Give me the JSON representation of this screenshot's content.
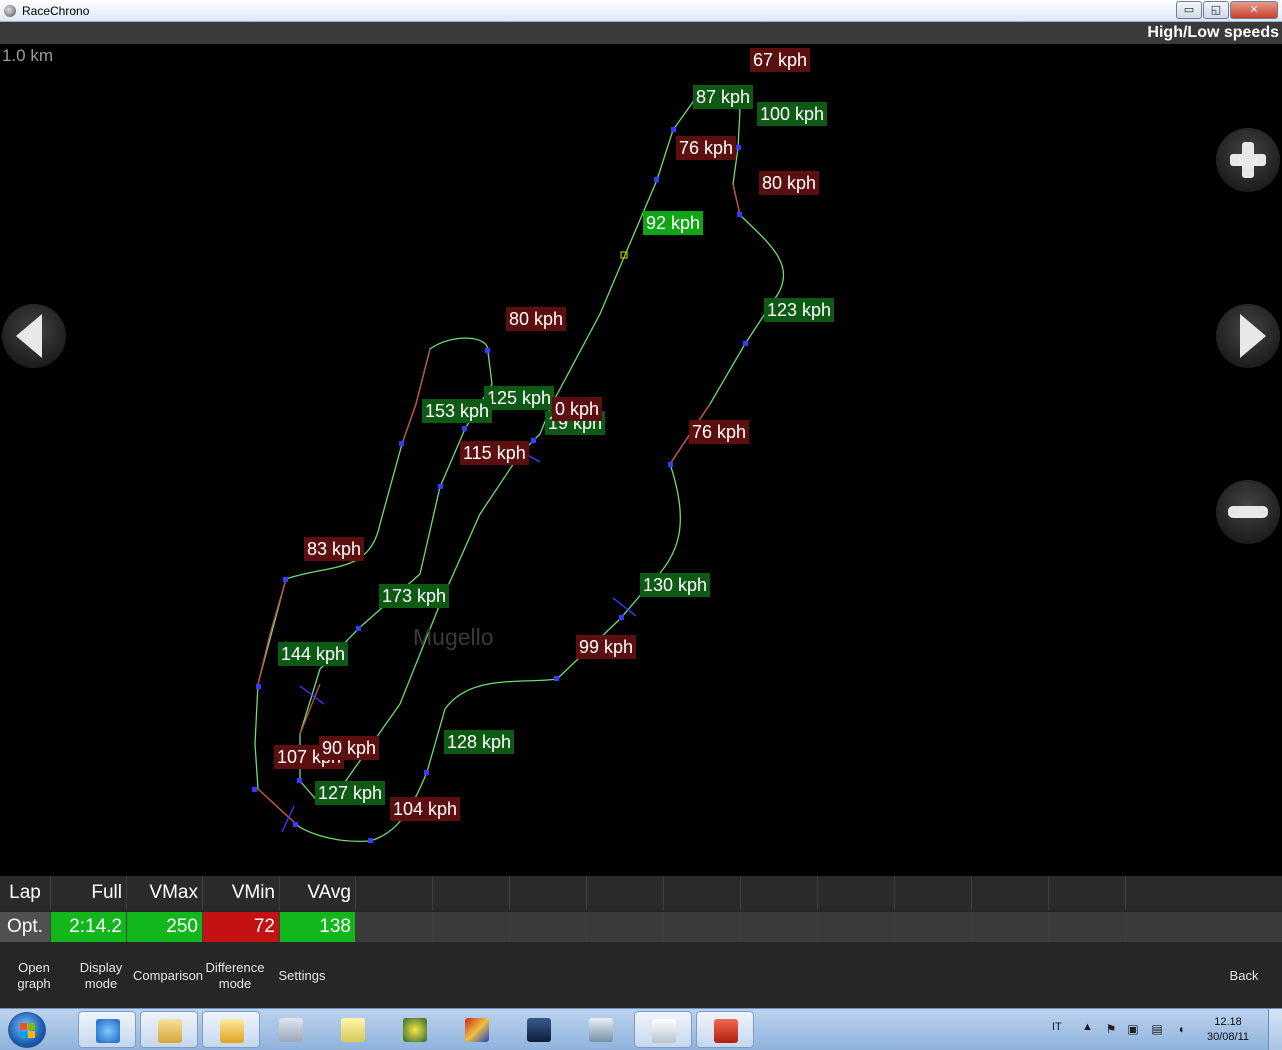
{
  "window": {
    "title": "RaceChrono",
    "min_label": "▭",
    "max_label": "◱",
    "close_label": "✕"
  },
  "header": {
    "mode_label": "High/Low speeds"
  },
  "map": {
    "scale_label": "1.0 km",
    "track_name": "Mugello",
    "colors": {
      "high_label_bg": "#0e5a14",
      "low_label_bg": "#5c0f0f",
      "best_label_bg": "#0ea615",
      "fast_line": "#6fdc6f",
      "slow_line": "#c44a4a"
    },
    "speed_labels": [
      {
        "text": "67 kph",
        "kind": "low"
      },
      {
        "text": "87 kph",
        "kind": "high"
      },
      {
        "text": "100 kph",
        "kind": "high"
      },
      {
        "text": "76 kph",
        "kind": "low"
      },
      {
        "text": "80 kph",
        "kind": "low"
      },
      {
        "text": "92 kph",
        "kind": "best"
      },
      {
        "text": "123 kph",
        "kind": "high"
      },
      {
        "text": "80 kph",
        "kind": "low"
      },
      {
        "text": "125 kph",
        "kind": "high"
      },
      {
        "text": "153 kph",
        "kind": "high"
      },
      {
        "text": "19 kph",
        "kind": "high"
      },
      {
        "text": "0 kph",
        "kind": "low"
      },
      {
        "text": "115 kph",
        "kind": "low"
      },
      {
        "text": "76 kph",
        "kind": "low"
      },
      {
        "text": "83 kph",
        "kind": "low"
      },
      {
        "text": "173 kph",
        "kind": "high"
      },
      {
        "text": "130 kph",
        "kind": "high"
      },
      {
        "text": "144 kph",
        "kind": "high"
      },
      {
        "text": "99 kph",
        "kind": "low"
      },
      {
        "text": "128 kph",
        "kind": "high"
      },
      {
        "text": "107 kph",
        "kind": "low"
      },
      {
        "text": "90 kph",
        "kind": "low"
      },
      {
        "text": "127 kph",
        "kind": "high"
      },
      {
        "text": "104 kph",
        "kind": "low"
      }
    ],
    "buttons": {
      "zoom_in": "plus-icon",
      "zoom_out": "minus-icon",
      "previous": "arrow-left-icon",
      "next": "arrow-right-icon"
    }
  },
  "lap_table": {
    "headers": {
      "lap": "Lap",
      "full": "Full",
      "vmax": "VMax",
      "vmin": "VMin",
      "vavg": "VAvg"
    },
    "row": {
      "lap": "Opt.",
      "full": "2:14.2",
      "vmax": "250",
      "vmin": "72",
      "vavg": "138"
    },
    "colors": {
      "good": "#12b71b",
      "bad": "#c41212"
    }
  },
  "menu": {
    "open_graph": [
      "Open",
      "graph"
    ],
    "display_mode": [
      "Display",
      "mode"
    ],
    "comparison": "Comparison",
    "difference_mode": [
      "Difference",
      "mode"
    ],
    "settings": "Settings",
    "back": "Back"
  },
  "taskbar": {
    "apps": [
      "internet-explorer-icon",
      "file-explorer-icon",
      "outlook-icon",
      "calculator-icon",
      "sticky-notes-icon",
      "gcpm-icon",
      "game-icon",
      "cursor-app-icon",
      "window-app-icon",
      "document-icon",
      "racechrono-icon"
    ],
    "language": "IT",
    "time": "12.18",
    "date": "30/08/11"
  }
}
